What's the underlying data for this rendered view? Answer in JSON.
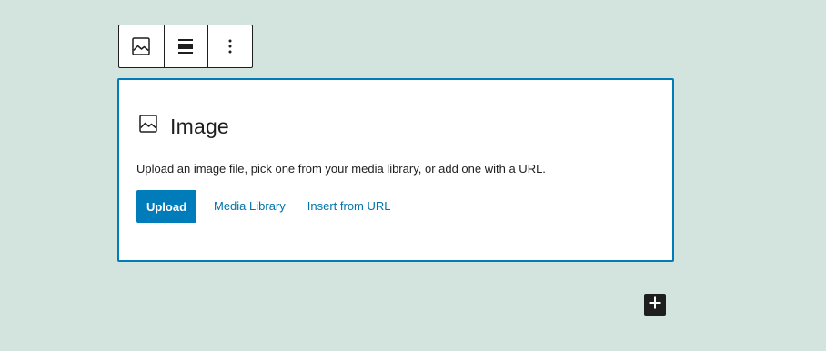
{
  "toolbar": {
    "buttons": [
      {
        "name": "block-type",
        "icon": "image-icon"
      },
      {
        "name": "align",
        "icon": "align-center-icon"
      },
      {
        "name": "more-options",
        "icon": "more-vertical-icon"
      }
    ]
  },
  "block": {
    "icon": "image-icon",
    "title": "Image",
    "instructions": "Upload an image file, pick one from your media library, or add one with a URL.",
    "upload_label": "Upload",
    "media_library_label": "Media Library",
    "insert_url_label": "Insert from URL"
  },
  "inserter": {
    "icon": "plus-icon"
  },
  "colors": {
    "background": "#d3e4df",
    "accent": "#007cba",
    "link": "#0073aa",
    "text": "#1e1e1e"
  }
}
